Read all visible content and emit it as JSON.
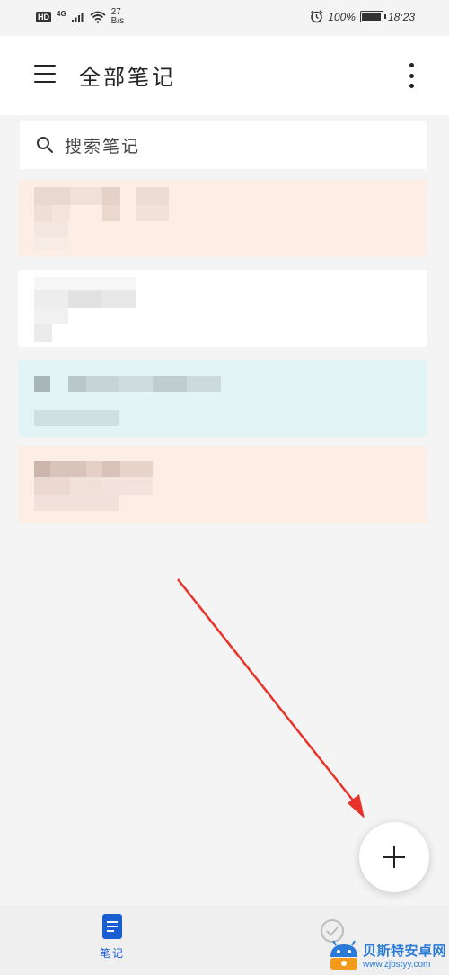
{
  "status_bar": {
    "hd_badge": "HD",
    "network_type": "4G",
    "speed_value": "27",
    "speed_unit": "B/s",
    "battery_text": "100%",
    "battery_level": 1.0,
    "time": "18:23"
  },
  "app_bar": {
    "title": "全部笔记",
    "menu_icon": "hamburger-menu-icon",
    "more_icon": "more-vertical-icon"
  },
  "search": {
    "placeholder": "搜索笔记",
    "icon": "search-icon"
  },
  "notes": [
    {
      "background": "#fdeee5",
      "content": "blurred"
    },
    {
      "background": "#ffffff",
      "content": "blurred"
    },
    {
      "background": "#e3f4f7",
      "content": "blurred"
    },
    {
      "background": "#fdeee5",
      "content": "blurred"
    }
  ],
  "fab": {
    "icon": "plus-icon"
  },
  "annotation": {
    "arrow_color": "#e8322a",
    "points_to": "add-note-button"
  },
  "bottom_nav": {
    "notes_label": "笔记",
    "notes_icon": "document-icon",
    "todo_icon": "check-circle-icon",
    "active_color": "#1a5fd1"
  },
  "watermark": {
    "title": "贝斯特安卓网",
    "url": "www.zjbstyy.com"
  }
}
